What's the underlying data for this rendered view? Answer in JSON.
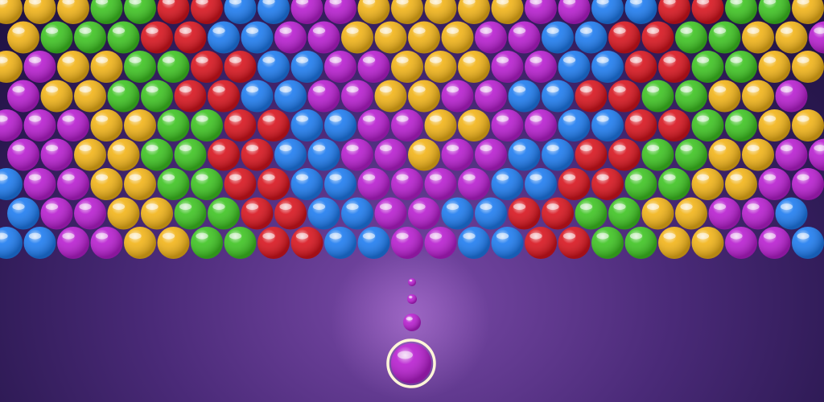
{
  "game": {
    "title": "",
    "colors": {
      "yellow": "#f2b418",
      "green": "#3ec422",
      "red": "#d8141e",
      "blue": "#1e7cf0",
      "purple": "#b81ed0"
    },
    "grid_rows": [
      "yyyggrrbbppyyyyyppbbrrggyy",
      "ygggrrbbppyyyyppbbrrggyyp",
      "ypyyggrrbbppyyyppbbrrggyyp",
      "pyyggrrbbppyyppbbrrggyyp",
      "pppyyggrrbbppyyppbbrrggyyp",
      "ppyyggrrbbppyppbbrrggyypp",
      "bppyyggrrbbppppbbrrggyyppb",
      "bppyyggrrbbppbbrrggyyppb",
      "bbppyyggrrbbppbbrrggyyppbb"
    ],
    "shooter": {
      "current_color": "purple"
    },
    "aim_dots": 3
  }
}
